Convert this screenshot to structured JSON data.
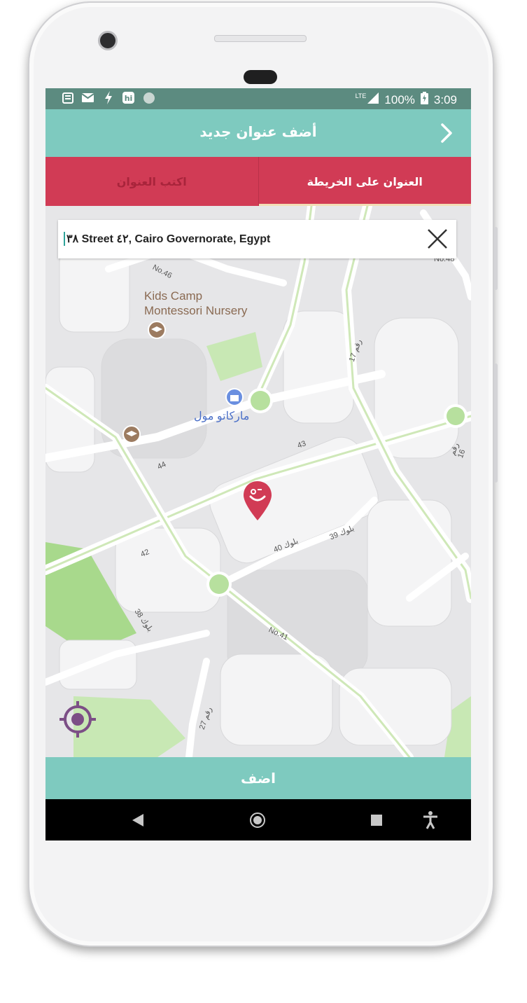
{
  "colors": {
    "statusbar": "#5c8b80",
    "primary_teal": "#7ecabf",
    "tab_red": "#d13b55",
    "pin": "#d13b55",
    "locate_icon": "#7c4e86"
  },
  "statusbar": {
    "left_icons": [
      "news-icon",
      "mail-icon",
      "flash-icon",
      "hi-icon",
      "dot-icon"
    ],
    "network": "LTE",
    "battery": "100%",
    "time": "3:09"
  },
  "appbar": {
    "title": "أضف عنوان جديد",
    "back_icon": "chevron-right-icon"
  },
  "tabs": [
    {
      "label": "العنوان على الخريطة",
      "active": true
    },
    {
      "label": "اكتب العنوان",
      "active": false
    }
  ],
  "search": {
    "value": "٣٨ Street ٤٢, Cairo Governorate, Egypt",
    "clear_icon": "close-icon"
  },
  "map": {
    "places": [
      {
        "name": "Kids Camp\nMontessori Nursery",
        "icon": "school-icon"
      },
      {
        "name": "ماركاتو مول",
        "icon": "shopping-icon"
      },
      {
        "name": "",
        "icon": "school-icon"
      }
    ],
    "street_labels": [
      "No.46",
      "No.48",
      "رقم 17",
      "43",
      "44",
      "رقم 16",
      "42",
      "بلوك 40",
      "بلوك 39",
      "بلوك 38",
      "No.41",
      "رقم 27"
    ],
    "pin_icon": "location-pin-icon",
    "locate_icon": "my-location-icon"
  },
  "add_button": {
    "label": "اضف"
  },
  "navbar": {
    "items": [
      "back-icon",
      "home-icon",
      "recents-icon",
      "accessibility-icon"
    ]
  }
}
